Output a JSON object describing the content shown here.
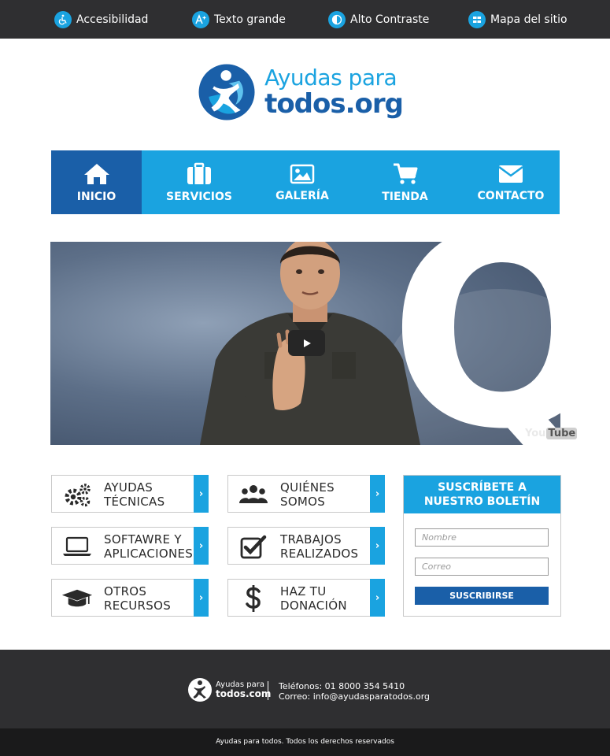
{
  "topbar": {
    "items": [
      {
        "label": "Accesibilidad",
        "icon": "wheelchair-icon"
      },
      {
        "label": "Texto grande",
        "icon": "text-size-icon"
      },
      {
        "label": "Alto Contraste",
        "icon": "contrast-icon"
      },
      {
        "label": "Mapa del sitio",
        "icon": "sitemap-icon"
      }
    ]
  },
  "logo": {
    "line1": "Ayudas para",
    "line2": "todos.org"
  },
  "nav": {
    "items": [
      {
        "label": "INICIO",
        "icon": "home-icon",
        "active": true
      },
      {
        "label": "SERVICIOS",
        "icon": "briefcase-icon"
      },
      {
        "label": "GALERÍA",
        "icon": "image-icon"
      },
      {
        "label": "TIENDA",
        "icon": "cart-icon"
      },
      {
        "label": "CONTACTO",
        "icon": "envelope-icon"
      }
    ]
  },
  "video": {
    "watermark_you": "You",
    "watermark_tube": "Tube",
    "letter": "Q"
  },
  "tiles": [
    {
      "line1": "AYUDAS",
      "line2": "TÉCNICAS",
      "icon": "gears-icon"
    },
    {
      "line1": "QUIÉNES",
      "line2": "SOMOS",
      "icon": "users-icon"
    },
    {
      "line1": "SOFTAWRE Y",
      "line2": "APLICACIONES",
      "icon": "laptop-icon"
    },
    {
      "line1": "TRABAJOS",
      "line2": "REALIZADOS",
      "icon": "checkbox-icon"
    },
    {
      "line1": "OTROS",
      "line2": "RECURSOS",
      "icon": "graduation-cap-icon"
    },
    {
      "line1": "HAZ TU",
      "line2": "DONACIÓN",
      "icon": "dollar-icon"
    }
  ],
  "newsletter": {
    "title_line1": "SUSCRÍBETE A",
    "title_line2": "NUESTRO BOLETÍN",
    "name_placeholder": "Nombre",
    "email_placeholder": "Correo",
    "button": "SUSCRIBIRSE"
  },
  "footer": {
    "logo_line1": "Ayudas para",
    "logo_line2": "todos.com",
    "phone": "Teléfonos: 01 8000 354 5410",
    "email": "Correo: info@ayudasparatodos.org",
    "copyright": "Ayudas para todos. Todos los derechos reservados"
  },
  "colors": {
    "accent": "#1aa3e0",
    "dark_blue": "#1a5fa8",
    "topbar": "#2f2f31"
  }
}
